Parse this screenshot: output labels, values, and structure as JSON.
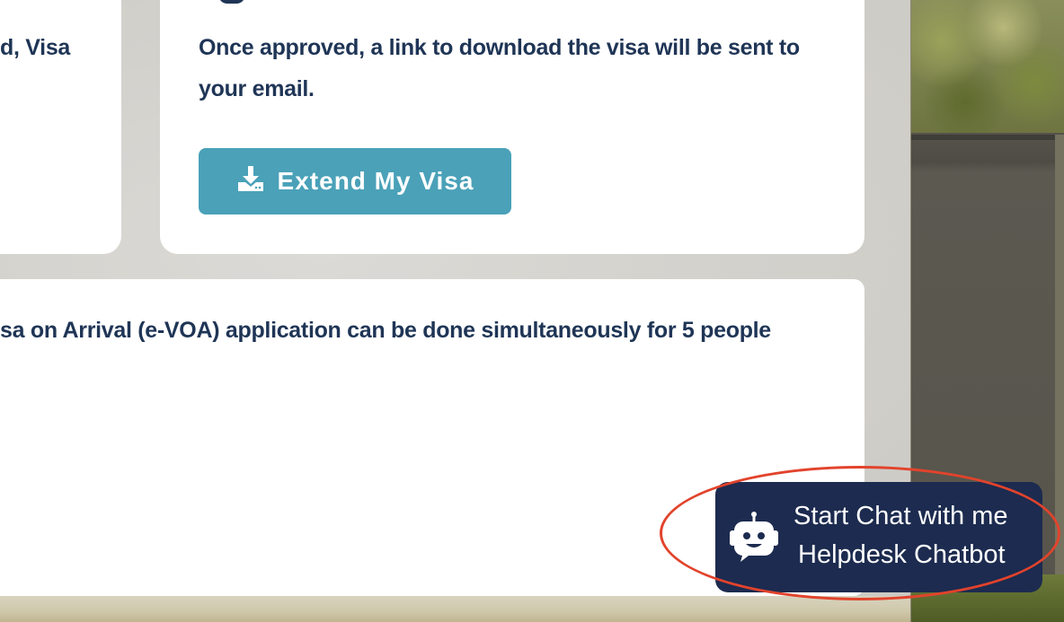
{
  "cards": {
    "left_fragment_text": "d, Visa",
    "approved_text": "Once approved, a link to download the visa will be sent to your email.",
    "extend_button_label": "Extend My Visa",
    "bottom_text": "sa on Arrival (e-VOA) application can be done simultaneously for 5 people"
  },
  "chat_widget": {
    "line1": "Start Chat with me",
    "line2": "Helpdesk Chatbot",
    "icon": "robot-icon"
  },
  "icons": {
    "extend_button_icon": "download-icon"
  },
  "colors": {
    "text_dark": "#1f3556",
    "button_bg": "#4aa1b8",
    "chat_bg": "#1c2b4f",
    "annotation": "#e2432c"
  }
}
